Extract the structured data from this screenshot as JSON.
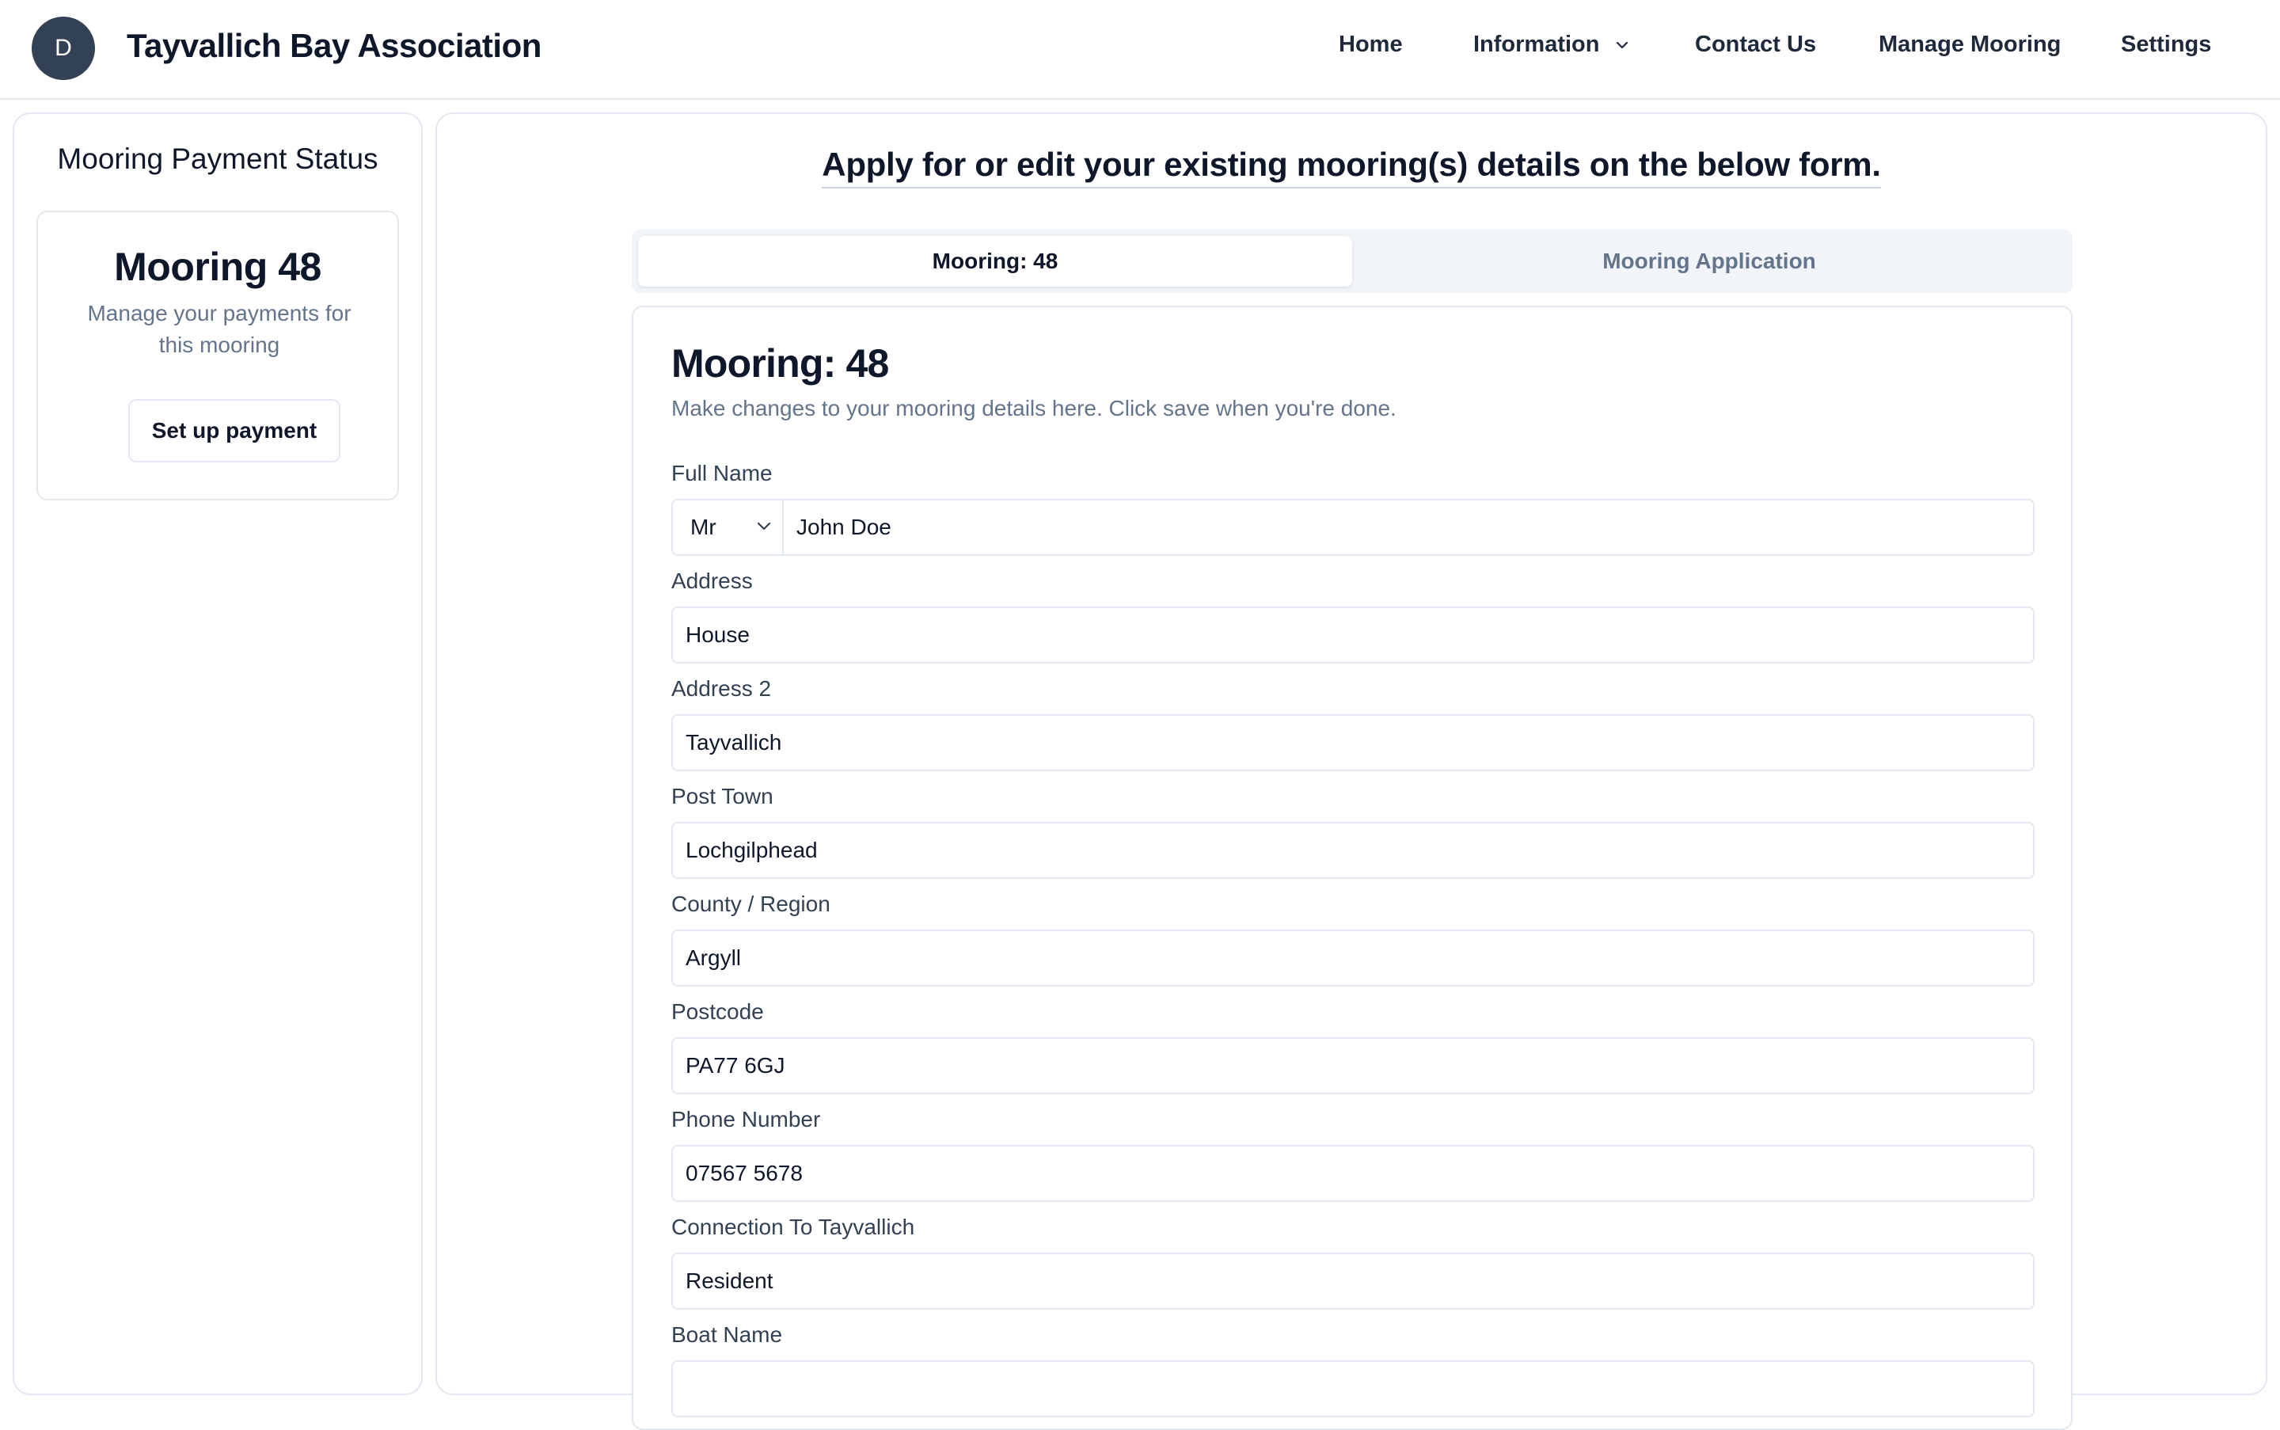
{
  "header": {
    "avatar_initial": "D",
    "site_title": "Tayvallich Bay Association",
    "nav": {
      "home": "Home",
      "information": "Information",
      "contact": "Contact Us",
      "manage_mooring": "Manage Mooring",
      "settings": "Settings"
    }
  },
  "sidebar": {
    "title": "Mooring Payment Status",
    "card": {
      "title": "Mooring 48",
      "description": "Manage your payments for this mooring",
      "button": "Set up payment"
    }
  },
  "main": {
    "heading": "Apply for or edit your existing mooring(s) details on the below form.",
    "tabs": {
      "active": "Mooring: 48",
      "inactive": "Mooring Application"
    },
    "form": {
      "title": "Mooring: 48",
      "description": "Make changes to your mooring details here. Click save when you're done.",
      "full_name": {
        "label": "Full Name",
        "title_value": "Mr",
        "value": "John Doe"
      },
      "address": {
        "label": "Address",
        "value": "House"
      },
      "address2": {
        "label": "Address 2",
        "value": "Tayvallich"
      },
      "post_town": {
        "label": "Post Town",
        "value": "Lochgilphead"
      },
      "county": {
        "label": "County / Region",
        "value": "Argyll"
      },
      "postcode": {
        "label": "Postcode",
        "value": "PA77 6GJ"
      },
      "phone": {
        "label": "Phone Number",
        "value": "07567 5678"
      },
      "connection": {
        "label": "Connection To Tayvallich",
        "value": "Resident"
      },
      "boat_name": {
        "label": "Boat Name"
      }
    }
  }
}
